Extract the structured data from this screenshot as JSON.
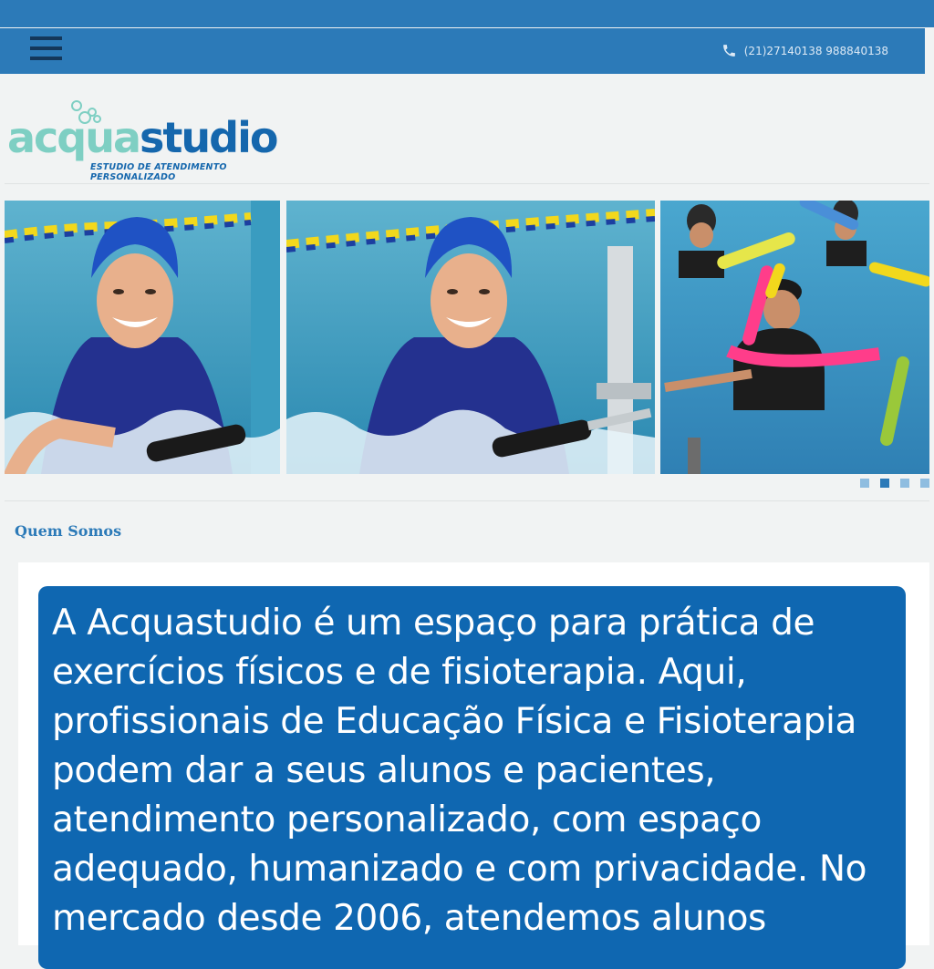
{
  "header": {
    "menu_icon": "hamburger-menu-icon",
    "phone_icon": "phone-icon",
    "phone_text": "(21)27140138 988840138"
  },
  "logo": {
    "name_part1": "acqua",
    "name_part2": "studio",
    "tagline": "ESTUDIO DE ATENDIMENTO PERSONALIZADO"
  },
  "slider": {
    "slides": [
      {
        "description": "swimmer-blue-cap"
      },
      {
        "description": "swimmer-blue-cap-rail"
      },
      {
        "description": "aqua-therapy-group"
      }
    ],
    "dots_count": 4,
    "active_dot": 2
  },
  "section": {
    "title": "Quem Somos"
  },
  "about": {
    "text": "A Acquastudio é um espaço para prática de exercícios físicos e de fisioterapia. Aqui, profissionais de Educação Física e Fisioterapia podem dar a seus alunos e pacientes, atendimento personalizado, com espaço adequado, humanizado e com privacidade. No mercado desde 2006, atendemos alunos"
  },
  "colors": {
    "brand_blue": "#2c7ab8",
    "logo_teal": "#7ecfc3",
    "logo_blue": "#1567ad",
    "about_box": "#0f67b1"
  }
}
